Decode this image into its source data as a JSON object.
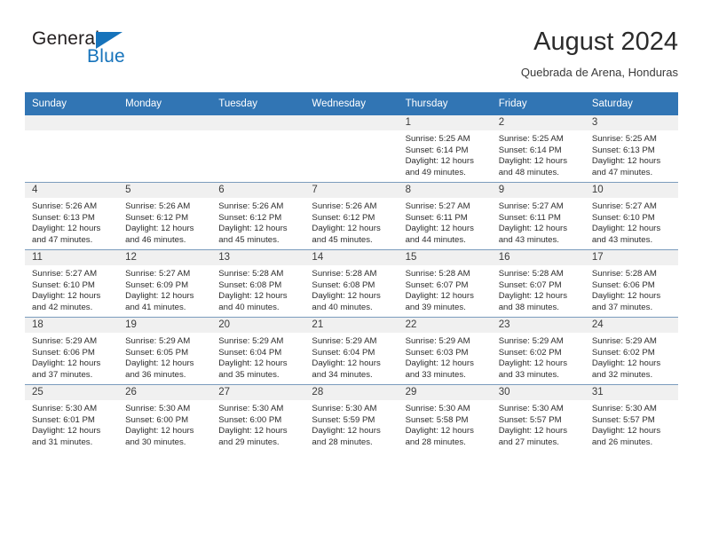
{
  "brand": {
    "name_part1": "General",
    "name_part2": "Blue",
    "primary_color": "#1673bb",
    "triangle_icon": "triangle-icon"
  },
  "header": {
    "title": "August 2024",
    "subtitle": "Quebrada de Arena, Honduras"
  },
  "calendar": {
    "header_bg": "#3175b4",
    "daynum_bg": "#f0f0f0",
    "weekdays": [
      "Sunday",
      "Monday",
      "Tuesday",
      "Wednesday",
      "Thursday",
      "Friday",
      "Saturday"
    ],
    "weeks": [
      [
        {
          "day": "",
          "empty": true
        },
        {
          "day": "",
          "empty": true
        },
        {
          "day": "",
          "empty": true
        },
        {
          "day": "",
          "empty": true
        },
        {
          "day": "1",
          "sunrise": "Sunrise: 5:25 AM",
          "sunset": "Sunset: 6:14 PM",
          "daylight1": "Daylight: 12 hours",
          "daylight2": "and 49 minutes."
        },
        {
          "day": "2",
          "sunrise": "Sunrise: 5:25 AM",
          "sunset": "Sunset: 6:14 PM",
          "daylight1": "Daylight: 12 hours",
          "daylight2": "and 48 minutes."
        },
        {
          "day": "3",
          "sunrise": "Sunrise: 5:25 AM",
          "sunset": "Sunset: 6:13 PM",
          "daylight1": "Daylight: 12 hours",
          "daylight2": "and 47 minutes."
        }
      ],
      [
        {
          "day": "4",
          "sunrise": "Sunrise: 5:26 AM",
          "sunset": "Sunset: 6:13 PM",
          "daylight1": "Daylight: 12 hours",
          "daylight2": "and 47 minutes."
        },
        {
          "day": "5",
          "sunrise": "Sunrise: 5:26 AM",
          "sunset": "Sunset: 6:12 PM",
          "daylight1": "Daylight: 12 hours",
          "daylight2": "and 46 minutes."
        },
        {
          "day": "6",
          "sunrise": "Sunrise: 5:26 AM",
          "sunset": "Sunset: 6:12 PM",
          "daylight1": "Daylight: 12 hours",
          "daylight2": "and 45 minutes."
        },
        {
          "day": "7",
          "sunrise": "Sunrise: 5:26 AM",
          "sunset": "Sunset: 6:12 PM",
          "daylight1": "Daylight: 12 hours",
          "daylight2": "and 45 minutes."
        },
        {
          "day": "8",
          "sunrise": "Sunrise: 5:27 AM",
          "sunset": "Sunset: 6:11 PM",
          "daylight1": "Daylight: 12 hours",
          "daylight2": "and 44 minutes."
        },
        {
          "day": "9",
          "sunrise": "Sunrise: 5:27 AM",
          "sunset": "Sunset: 6:11 PM",
          "daylight1": "Daylight: 12 hours",
          "daylight2": "and 43 minutes."
        },
        {
          "day": "10",
          "sunrise": "Sunrise: 5:27 AM",
          "sunset": "Sunset: 6:10 PM",
          "daylight1": "Daylight: 12 hours",
          "daylight2": "and 43 minutes."
        }
      ],
      [
        {
          "day": "11",
          "sunrise": "Sunrise: 5:27 AM",
          "sunset": "Sunset: 6:10 PM",
          "daylight1": "Daylight: 12 hours",
          "daylight2": "and 42 minutes."
        },
        {
          "day": "12",
          "sunrise": "Sunrise: 5:27 AM",
          "sunset": "Sunset: 6:09 PM",
          "daylight1": "Daylight: 12 hours",
          "daylight2": "and 41 minutes."
        },
        {
          "day": "13",
          "sunrise": "Sunrise: 5:28 AM",
          "sunset": "Sunset: 6:08 PM",
          "daylight1": "Daylight: 12 hours",
          "daylight2": "and 40 minutes."
        },
        {
          "day": "14",
          "sunrise": "Sunrise: 5:28 AM",
          "sunset": "Sunset: 6:08 PM",
          "daylight1": "Daylight: 12 hours",
          "daylight2": "and 40 minutes."
        },
        {
          "day": "15",
          "sunrise": "Sunrise: 5:28 AM",
          "sunset": "Sunset: 6:07 PM",
          "daylight1": "Daylight: 12 hours",
          "daylight2": "and 39 minutes."
        },
        {
          "day": "16",
          "sunrise": "Sunrise: 5:28 AM",
          "sunset": "Sunset: 6:07 PM",
          "daylight1": "Daylight: 12 hours",
          "daylight2": "and 38 minutes."
        },
        {
          "day": "17",
          "sunrise": "Sunrise: 5:28 AM",
          "sunset": "Sunset: 6:06 PM",
          "daylight1": "Daylight: 12 hours",
          "daylight2": "and 37 minutes."
        }
      ],
      [
        {
          "day": "18",
          "sunrise": "Sunrise: 5:29 AM",
          "sunset": "Sunset: 6:06 PM",
          "daylight1": "Daylight: 12 hours",
          "daylight2": "and 37 minutes."
        },
        {
          "day": "19",
          "sunrise": "Sunrise: 5:29 AM",
          "sunset": "Sunset: 6:05 PM",
          "daylight1": "Daylight: 12 hours",
          "daylight2": "and 36 minutes."
        },
        {
          "day": "20",
          "sunrise": "Sunrise: 5:29 AM",
          "sunset": "Sunset: 6:04 PM",
          "daylight1": "Daylight: 12 hours",
          "daylight2": "and 35 minutes."
        },
        {
          "day": "21",
          "sunrise": "Sunrise: 5:29 AM",
          "sunset": "Sunset: 6:04 PM",
          "daylight1": "Daylight: 12 hours",
          "daylight2": "and 34 minutes."
        },
        {
          "day": "22",
          "sunrise": "Sunrise: 5:29 AM",
          "sunset": "Sunset: 6:03 PM",
          "daylight1": "Daylight: 12 hours",
          "daylight2": "and 33 minutes."
        },
        {
          "day": "23",
          "sunrise": "Sunrise: 5:29 AM",
          "sunset": "Sunset: 6:02 PM",
          "daylight1": "Daylight: 12 hours",
          "daylight2": "and 33 minutes."
        },
        {
          "day": "24",
          "sunrise": "Sunrise: 5:29 AM",
          "sunset": "Sunset: 6:02 PM",
          "daylight1": "Daylight: 12 hours",
          "daylight2": "and 32 minutes."
        }
      ],
      [
        {
          "day": "25",
          "sunrise": "Sunrise: 5:30 AM",
          "sunset": "Sunset: 6:01 PM",
          "daylight1": "Daylight: 12 hours",
          "daylight2": "and 31 minutes."
        },
        {
          "day": "26",
          "sunrise": "Sunrise: 5:30 AM",
          "sunset": "Sunset: 6:00 PM",
          "daylight1": "Daylight: 12 hours",
          "daylight2": "and 30 minutes."
        },
        {
          "day": "27",
          "sunrise": "Sunrise: 5:30 AM",
          "sunset": "Sunset: 6:00 PM",
          "daylight1": "Daylight: 12 hours",
          "daylight2": "and 29 minutes."
        },
        {
          "day": "28",
          "sunrise": "Sunrise: 5:30 AM",
          "sunset": "Sunset: 5:59 PM",
          "daylight1": "Daylight: 12 hours",
          "daylight2": "and 28 minutes."
        },
        {
          "day": "29",
          "sunrise": "Sunrise: 5:30 AM",
          "sunset": "Sunset: 5:58 PM",
          "daylight1": "Daylight: 12 hours",
          "daylight2": "and 28 minutes."
        },
        {
          "day": "30",
          "sunrise": "Sunrise: 5:30 AM",
          "sunset": "Sunset: 5:57 PM",
          "daylight1": "Daylight: 12 hours",
          "daylight2": "and 27 minutes."
        },
        {
          "day": "31",
          "sunrise": "Sunrise: 5:30 AM",
          "sunset": "Sunset: 5:57 PM",
          "daylight1": "Daylight: 12 hours",
          "daylight2": "and 26 minutes."
        }
      ]
    ]
  }
}
